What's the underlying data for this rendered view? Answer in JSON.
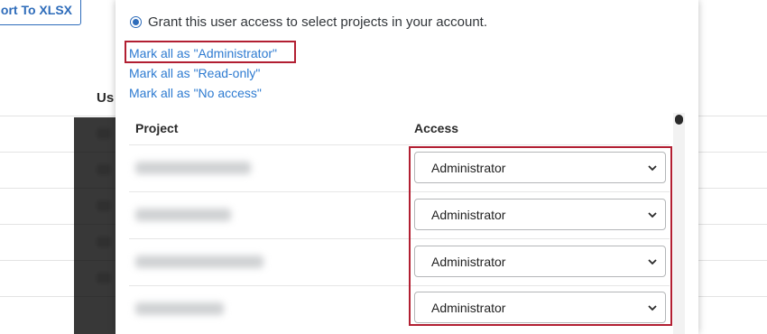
{
  "background": {
    "export_button_label": "ort To XLSX",
    "column_header_partial": "Us"
  },
  "modal": {
    "radio_label": "Grant this user access to select projects in your account.",
    "links": {
      "mark_admin": "Mark all as \"Administrator\"",
      "mark_readonly": "Mark all as \"Read-only\"",
      "mark_noaccess": "Mark all as \"No access\""
    },
    "table": {
      "headers": {
        "project": "Project",
        "access": "Access"
      },
      "rows": [
        {
          "access": "Administrator"
        },
        {
          "access": "Administrator"
        },
        {
          "access": "Administrator"
        },
        {
          "access": "Administrator"
        }
      ]
    }
  },
  "colors": {
    "accent": "#2e7bd1",
    "highlight": "#b21f32"
  }
}
